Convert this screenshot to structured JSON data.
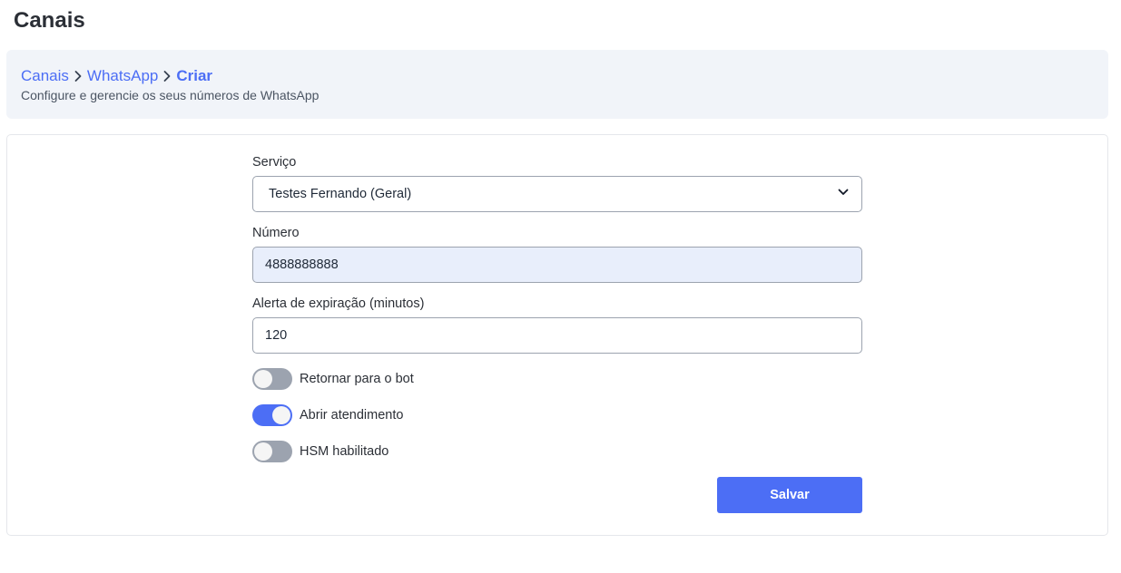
{
  "page": {
    "title": "Canais"
  },
  "header": {
    "breadcrumb": [
      "Canais",
      "WhatsApp",
      "Criar"
    ],
    "subtitle": "Configure e gerencie os seus números de WhatsApp"
  },
  "form": {
    "service": {
      "label": "Serviço",
      "value": "Testes Fernando (Geral)"
    },
    "number": {
      "label": "Número",
      "value": "4888888888"
    },
    "expiration_alert": {
      "label": "Alerta de expiração (minutos)",
      "value": "120"
    },
    "toggles": [
      {
        "label": "Retornar para o bot",
        "on": false
      },
      {
        "label": "Abrir atendimento",
        "on": true
      },
      {
        "label": "HSM habilitado",
        "on": false
      }
    ],
    "save_label": "Salvar"
  },
  "colors": {
    "accent": "#4c6ef5",
    "toggle_off": "#9ca3af",
    "header_bg": "#f1f4f9"
  },
  "icons": {
    "breadcrumb_separator": "chevron-right-icon",
    "select_arrow": "chevron-down-icon"
  }
}
